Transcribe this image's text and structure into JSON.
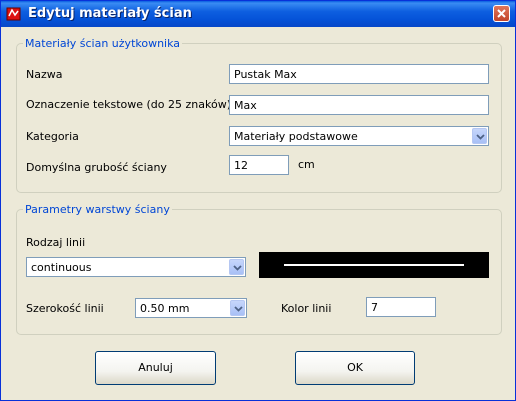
{
  "window": {
    "title": "Edytuj materiały ścian"
  },
  "group_user": {
    "legend": "Materiały ścian użytkownika",
    "name_label": "Nazwa",
    "name_value": "Pustak Max",
    "text_label": "Oznaczenie tekstowe (do 25 znaków)",
    "text_value": "Max",
    "category_label": "Kategoria",
    "category_value": "Materiały podstawowe",
    "thickness_label": "Domyślna grubość ściany",
    "thickness_value": "12",
    "thickness_unit": "cm"
  },
  "group_layer": {
    "legend": "Parametry warstwy ściany",
    "line_type_label": "Rodzaj linii",
    "line_type_value": "continuous",
    "line_width_label": "Szerokość linii",
    "line_width_value": "0.50 mm",
    "line_color_label": "Kolor linii",
    "line_color_value": "7"
  },
  "buttons": {
    "cancel": "Anuluj",
    "ok": "OK"
  },
  "colors": {
    "titlebar": "#0553d8",
    "face": "#ece9d8",
    "legend": "#0046d5",
    "preview_bg": "#000000",
    "preview_line": "#ffffff"
  }
}
